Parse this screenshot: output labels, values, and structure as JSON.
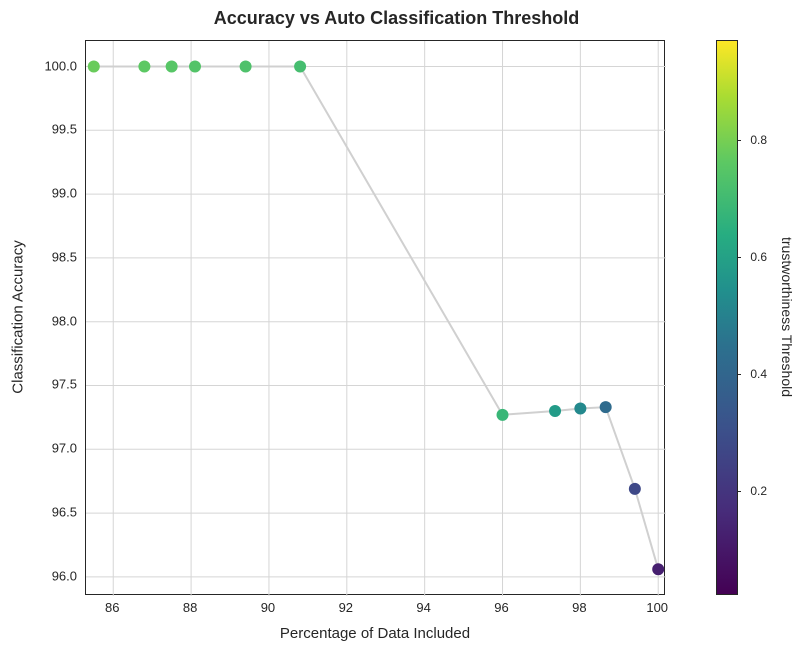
{
  "chart_data": {
    "type": "scatter",
    "title": "Accuracy vs Auto Classification Threshold",
    "xlabel": "Percentage of Data Included",
    "ylabel": "Classification Accuracy",
    "colorbar_label": "trustworthiness Threshold",
    "xlim": [
      85.3,
      100.2
    ],
    "ylim": [
      95.85,
      100.2
    ],
    "x_ticks": [
      86,
      88,
      90,
      92,
      94,
      96,
      98,
      100
    ],
    "y_ticks": [
      96.0,
      96.5,
      97.0,
      97.5,
      98.0,
      98.5,
      99.0,
      99.5,
      100.0
    ],
    "cb_ticks": [
      0.2,
      0.4,
      0.6,
      0.8
    ],
    "cb_min": 0.02,
    "cb_max": 0.97,
    "series": [
      {
        "name": "accuracy",
        "points": [
          {
            "x": 85.5,
            "y": 100.0,
            "threshold": 0.78
          },
          {
            "x": 86.8,
            "y": 100.0,
            "threshold": 0.76
          },
          {
            "x": 87.5,
            "y": 100.0,
            "threshold": 0.75
          },
          {
            "x": 88.1,
            "y": 100.0,
            "threshold": 0.74
          },
          {
            "x": 89.4,
            "y": 100.0,
            "threshold": 0.73
          },
          {
            "x": 90.8,
            "y": 100.0,
            "threshold": 0.71
          },
          {
            "x": 96.0,
            "y": 97.27,
            "threshold": 0.68
          },
          {
            "x": 97.35,
            "y": 97.3,
            "threshold": 0.58
          },
          {
            "x": 98.0,
            "y": 97.32,
            "threshold": 0.52
          },
          {
            "x": 98.65,
            "y": 97.33,
            "threshold": 0.42
          },
          {
            "x": 99.4,
            "y": 96.69,
            "threshold": 0.27
          },
          {
            "x": 100.0,
            "y": 96.06,
            "threshold": 0.12
          }
        ]
      }
    ]
  }
}
